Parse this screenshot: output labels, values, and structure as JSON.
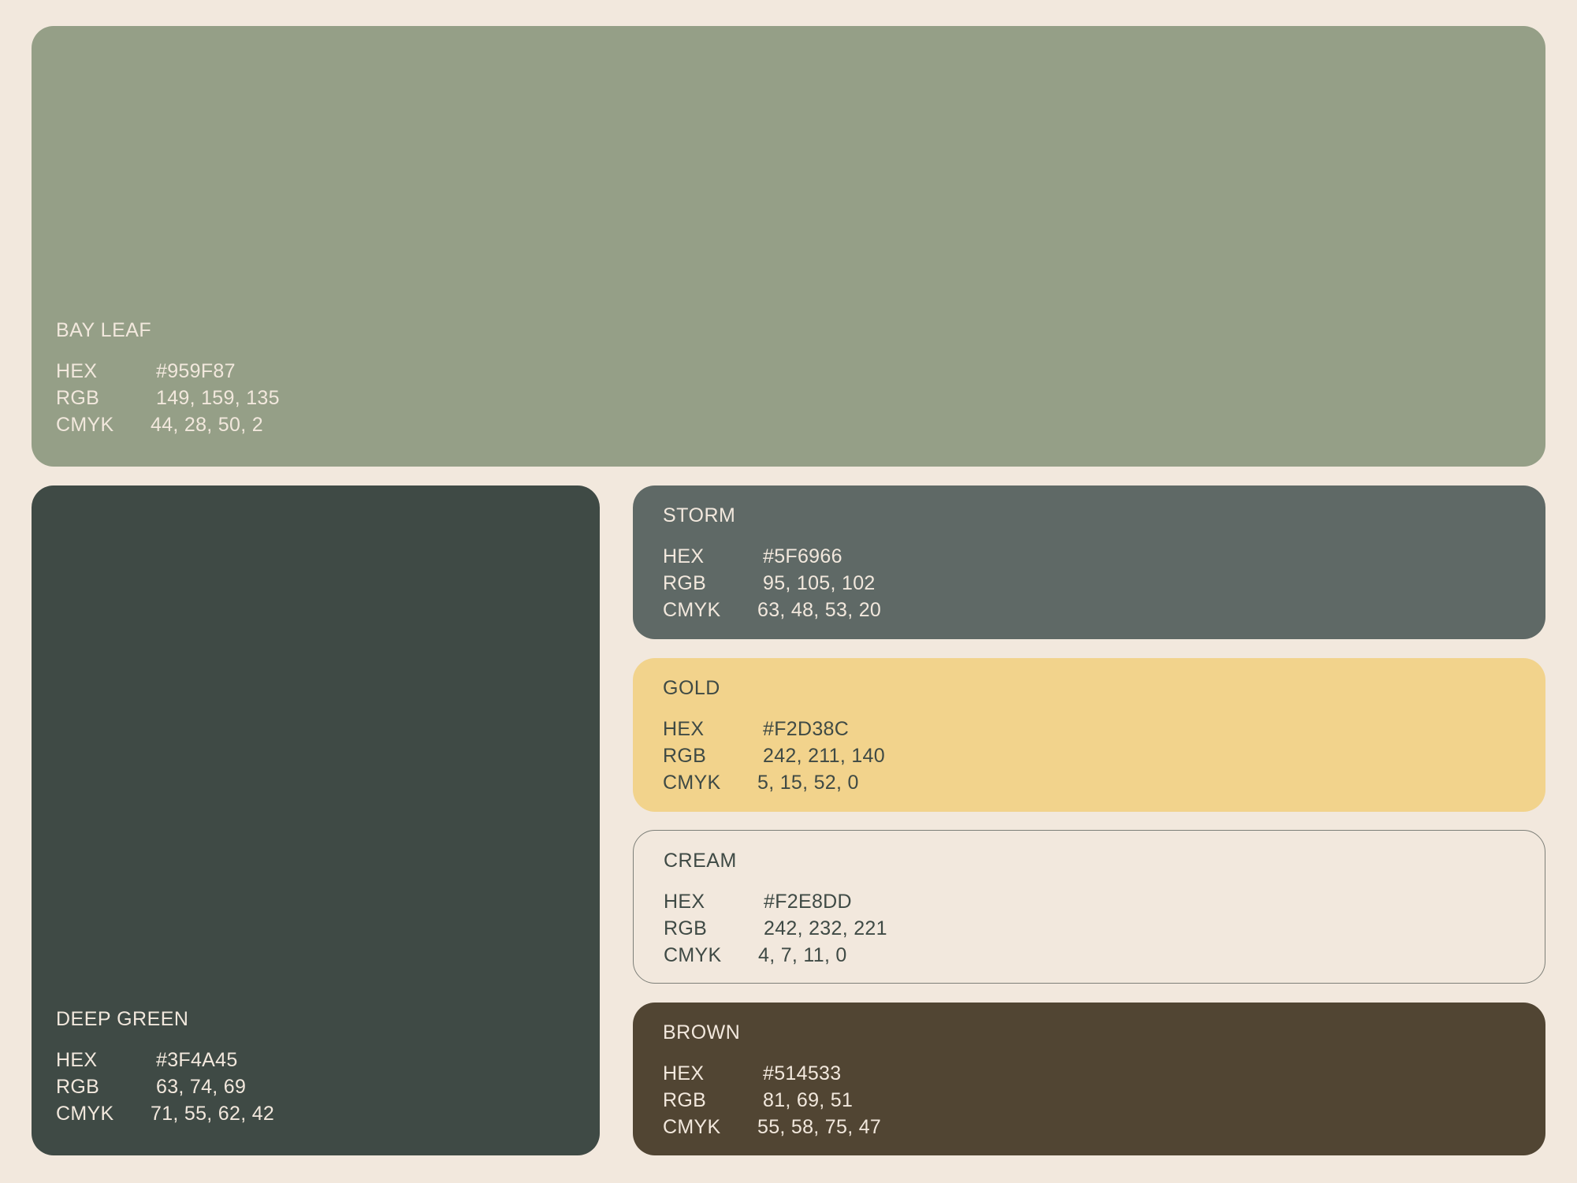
{
  "palette": {
    "background": "#F2E8DD",
    "swatches": [
      {
        "name": "BAY LEAF",
        "color": "#959F87",
        "text_color": "#F2E8DD",
        "hex_label": "HEX",
        "hex": "#959F87",
        "rgb_label": "RGB",
        "rgb": "149, 159, 135",
        "cmyk_label": "CMYK",
        "cmyk": "44, 28, 50, 2"
      },
      {
        "name": "DEEP GREEN",
        "color": "#3F4A45",
        "text_color": "#F2E8DD",
        "hex_label": "HEX",
        "hex": "#3F4A45",
        "rgb_label": "RGB",
        "rgb": "63, 74, 69",
        "cmyk_label": "CMYK",
        "cmyk": "71, 55, 62, 42"
      },
      {
        "name": "STORM",
        "color": "#5F6966",
        "text_color": "#F2E8DD",
        "hex_label": "HEX",
        "hex": "#5F6966",
        "rgb_label": "RGB",
        "rgb": "95, 105, 102",
        "cmyk_label": "CMYK",
        "cmyk": "63, 48, 53, 20"
      },
      {
        "name": "GOLD",
        "color": "#F2D38C",
        "text_color": "#3F4A45",
        "hex_label": "HEX",
        "hex": "#F2D38C",
        "rgb_label": "RGB",
        "rgb": "242, 211, 140",
        "cmyk_label": "CMYK",
        "cmyk": "5, 15, 52, 0"
      },
      {
        "name": "CREAM",
        "color": "#F2E8DD",
        "text_color": "#3F4A45",
        "hex_label": "HEX",
        "hex": "#F2E8DD",
        "rgb_label": "RGB",
        "rgb": "242, 232, 221",
        "cmyk_label": "CMYK",
        "cmyk": "4, 7, 11, 0"
      },
      {
        "name": "BROWN",
        "color": "#514533",
        "text_color": "#F2E8DD",
        "hex_label": "HEX",
        "hex": "#514533",
        "rgb_label": "RGB",
        "rgb": "81, 69, 51",
        "cmyk_label": "CMYK",
        "cmyk": "55, 58, 75, 47"
      }
    ]
  }
}
